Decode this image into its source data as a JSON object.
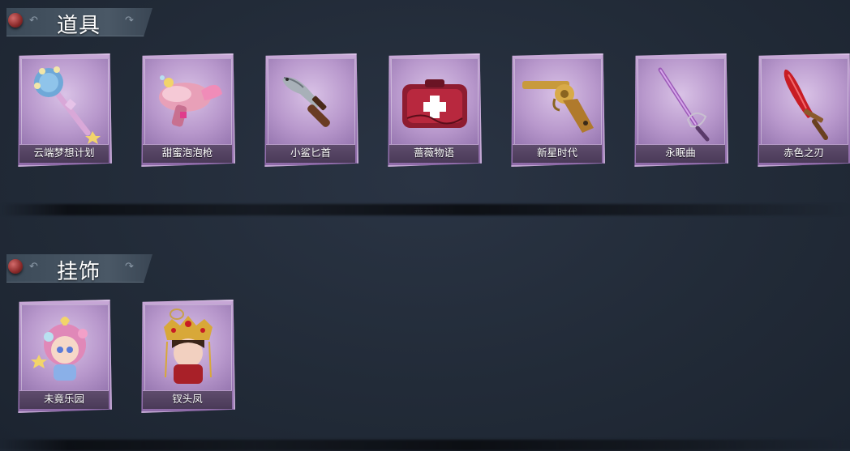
{
  "sections": [
    {
      "title": "道具",
      "items": [
        {
          "label": "云端梦想计划",
          "icon": "scepter-icon"
        },
        {
          "label": "甜蜜泡泡枪",
          "icon": "bubble-gun-icon"
        },
        {
          "label": "小鲨匕首",
          "icon": "shark-dagger-icon"
        },
        {
          "label": "蔷薇物语",
          "icon": "medkit-icon"
        },
        {
          "label": "新星时代",
          "icon": "revolver-icon"
        },
        {
          "label": "永眠曲",
          "icon": "rapier-icon"
        },
        {
          "label": "赤色之刃",
          "icon": "red-blade-icon"
        }
      ]
    },
    {
      "title": "挂饰",
      "items": [
        {
          "label": "未竟乐园",
          "icon": "doll-charm-icon"
        },
        {
          "label": "钗头凤",
          "icon": "phoenix-crown-charm-icon"
        }
      ]
    }
  ],
  "colors": {
    "background": "#222b38",
    "card_frame": "#a884c0",
    "pin": "#8a2a2a"
  }
}
